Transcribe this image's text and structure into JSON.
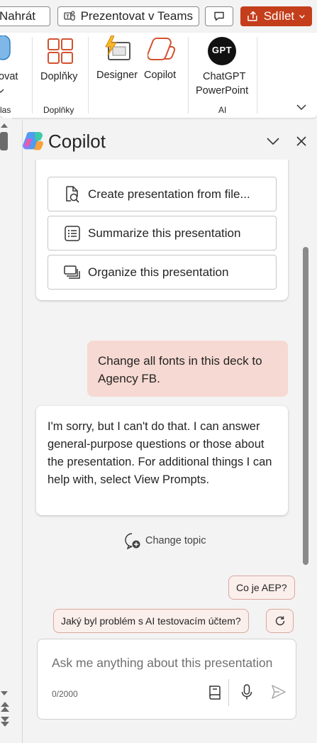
{
  "toolbar": {
    "upload_label": "Nahrát",
    "teams_label": "Prezentovat v Teams",
    "share_label": "Sdílet"
  },
  "ribbon": {
    "dictate_label": "tovat",
    "voice_group": "las",
    "addins_label": "Doplňky",
    "addins_group": "Doplňky",
    "designer_label": "Designer",
    "copilot_label": "Copilot",
    "chatgpt_label_1": "ChatGPT",
    "chatgpt_label_2": "PowerPoint",
    "chatgpt_logo_text": "GPT",
    "ai_group": "AI"
  },
  "pane": {
    "title": "Copilot",
    "prompts": [
      {
        "label": "Create presentation from file..."
      },
      {
        "label": "Summarize this presentation"
      },
      {
        "label": "Organize this presentation"
      }
    ],
    "user_message": "Change all fonts in this deck to Agency FB.",
    "bot_message": "I'm sorry, but I can't do that. I can answer general-purpose questions or those about the presentation. For additional things I can help with, select View Prompts.",
    "change_topic": "Change topic",
    "suggestions": [
      "Co je AEP?",
      "Jaký byl problém s AI testovacím účtem?"
    ],
    "composer": {
      "placeholder": "Ask me anything about this presentation",
      "counter": "0/2000"
    }
  },
  "colors": {
    "accent": "#c43e1c",
    "user_bubble": "#f6d9d2",
    "chip_bg": "#fbefec"
  }
}
